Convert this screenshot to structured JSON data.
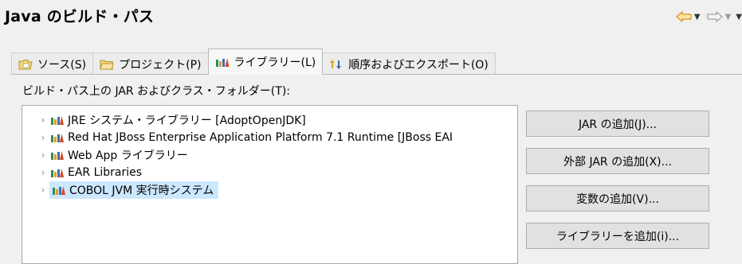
{
  "header": {
    "title": "Java のビルド・パス"
  },
  "tabs": [
    {
      "label": "ソース(S)",
      "icon": "source-folder-icon",
      "active": false
    },
    {
      "label": "プロジェクト(P)",
      "icon": "project-folder-icon",
      "active": false
    },
    {
      "label": "ライブラリー(L)",
      "icon": "library-icon",
      "active": true
    },
    {
      "label": "順序およびエクスポート(O)",
      "icon": "order-export-icon",
      "active": false
    }
  ],
  "tree": {
    "label": "ビルド・パス上の JAR およびクラス・フォルダー(T):",
    "items": [
      {
        "label": "JRE システム・ライブラリー [AdoptOpenJDK]",
        "selected": false
      },
      {
        "label": "Red Hat JBoss Enterprise Application Platform 7.1 Runtime [JBoss EAI",
        "selected": false
      },
      {
        "label": "Web App ライブラリー",
        "selected": false
      },
      {
        "label": "EAR Libraries",
        "selected": false
      },
      {
        "label": "COBOL JVM 実行時システム",
        "selected": true
      }
    ]
  },
  "buttons": {
    "add_jar": "JAR の追加(J)...",
    "add_external_jar": "外部 JAR の追加(X)...",
    "add_variable": "変数の追加(V)...",
    "add_library": "ライブラリーを追加(i)..."
  },
  "colors": {
    "selection": "#cce8ff",
    "nav_back": "#e4a020",
    "nav_forward_disabled": "#a0a0a0"
  }
}
